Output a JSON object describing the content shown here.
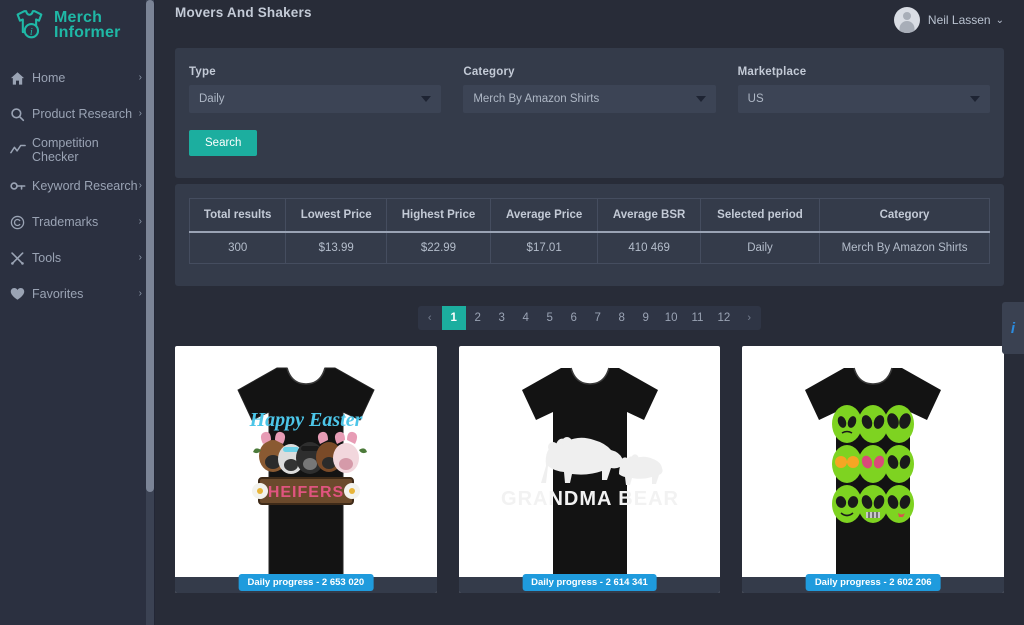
{
  "brand": {
    "name_line1": "Merch",
    "name_line2": "Informer",
    "logo_icon": "tshirt-info-icon",
    "accent_color": "#1fb8a6"
  },
  "sidebar": {
    "items": [
      {
        "label": "Home",
        "icon": "home-icon",
        "caret": "›",
        "has_caret": true
      },
      {
        "label": "Product Research",
        "icon": "search-icon",
        "caret": "›",
        "has_caret": true
      },
      {
        "label": "Competition Checker",
        "icon": "trend-line-icon",
        "caret": "",
        "has_caret": false
      },
      {
        "label": "Keyword Research",
        "icon": "key-icon",
        "caret": "›",
        "has_caret": true
      },
      {
        "label": "Trademarks",
        "icon": "copyright-icon",
        "caret": "›",
        "has_caret": true
      },
      {
        "label": "Tools",
        "icon": "tools-icon",
        "caret": "›",
        "has_caret": true
      },
      {
        "label": "Favorites",
        "icon": "heart-icon",
        "caret": "›",
        "has_caret": true
      }
    ]
  },
  "header": {
    "title": "Movers And Shakers",
    "user": {
      "name": "Neil Lassen",
      "caret": "⌄",
      "avatar_icon": "user-avatar-icon"
    }
  },
  "filters": {
    "type": {
      "label": "Type",
      "value": "Daily"
    },
    "category": {
      "label": "Category",
      "value": "Merch By Amazon Shirts"
    },
    "marketplace": {
      "label": "Marketplace",
      "value": "US"
    },
    "search_button": "Search",
    "accent_color": "#1cae9f"
  },
  "stats_table": {
    "headers": [
      "Total results",
      "Lowest Price",
      "Highest Price",
      "Average Price",
      "Average BSR",
      "Selected period",
      "Category"
    ],
    "rows": [
      [
        "300",
        "$13.99",
        "$22.99",
        "$17.01",
        "410 469",
        "Daily",
        "Merch By Amazon Shirts"
      ]
    ]
  },
  "pagination": {
    "prev": "‹",
    "next": "›",
    "pages": [
      "1",
      "2",
      "3",
      "4",
      "5",
      "6",
      "7",
      "8",
      "9",
      "10",
      "11",
      "12"
    ],
    "active": "1",
    "active_color": "#1cae9f"
  },
  "products": [
    {
      "design_name": "happy-easter-heifers-shirt",
      "title_text": "Happy Easter",
      "sub_text": "HEIFERS",
      "badge": "Daily progress - 2 653 020"
    },
    {
      "design_name": "grandma-bear-shirt",
      "title_text": "GRANDMA BEAR",
      "sub_text": "",
      "badge": "Daily progress - 2 614 341"
    },
    {
      "design_name": "alien-faces-shirt",
      "title_text": "",
      "sub_text": "",
      "badge": "Daily progress - 2 602 206"
    }
  ],
  "info_tab": {
    "glyph": "i",
    "icon": "info-icon",
    "color": "#2b8ce0"
  }
}
